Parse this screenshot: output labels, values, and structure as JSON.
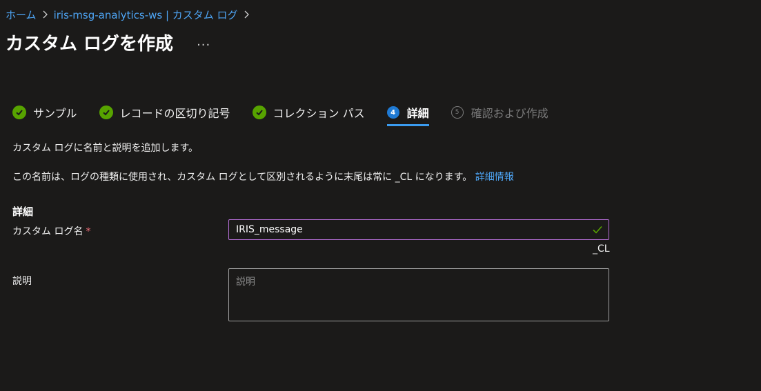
{
  "breadcrumb": {
    "items": [
      "ホーム",
      "iris-msg-analytics-ws | カスタム ログ"
    ]
  },
  "header": {
    "title": "カスタム ログを作成",
    "more_label": "..."
  },
  "wizard": {
    "steps": [
      {
        "label": "サンプル",
        "status": "complete"
      },
      {
        "label": "レコードの区切り記号",
        "status": "complete"
      },
      {
        "label": "コレクション パス",
        "status": "complete"
      },
      {
        "label": "詳細",
        "number": "4",
        "status": "active"
      },
      {
        "label": "確認および作成",
        "number": "5",
        "status": "disabled"
      }
    ]
  },
  "content": {
    "intro": "カスタム ログに名前と説明を追加します。",
    "info_text": "この名前は、ログの種類に使用され、カスタム ログとして区別されるように末尾は常に _CL になります。",
    "info_link": "詳細情報",
    "section_title": "詳細"
  },
  "form": {
    "name_label": "カスタム ログ名",
    "required_mark": "*",
    "name_value": "IRIS_message",
    "name_suffix": "_CL",
    "description_label": "説明",
    "description_placeholder": "説明"
  },
  "colors": {
    "background": "#1b1a19",
    "link": "#4ea5f5",
    "success": "#57a300",
    "active_step": "#1f7ad4",
    "input_focus_border": "#b56ed6",
    "required": "#f1707b"
  }
}
